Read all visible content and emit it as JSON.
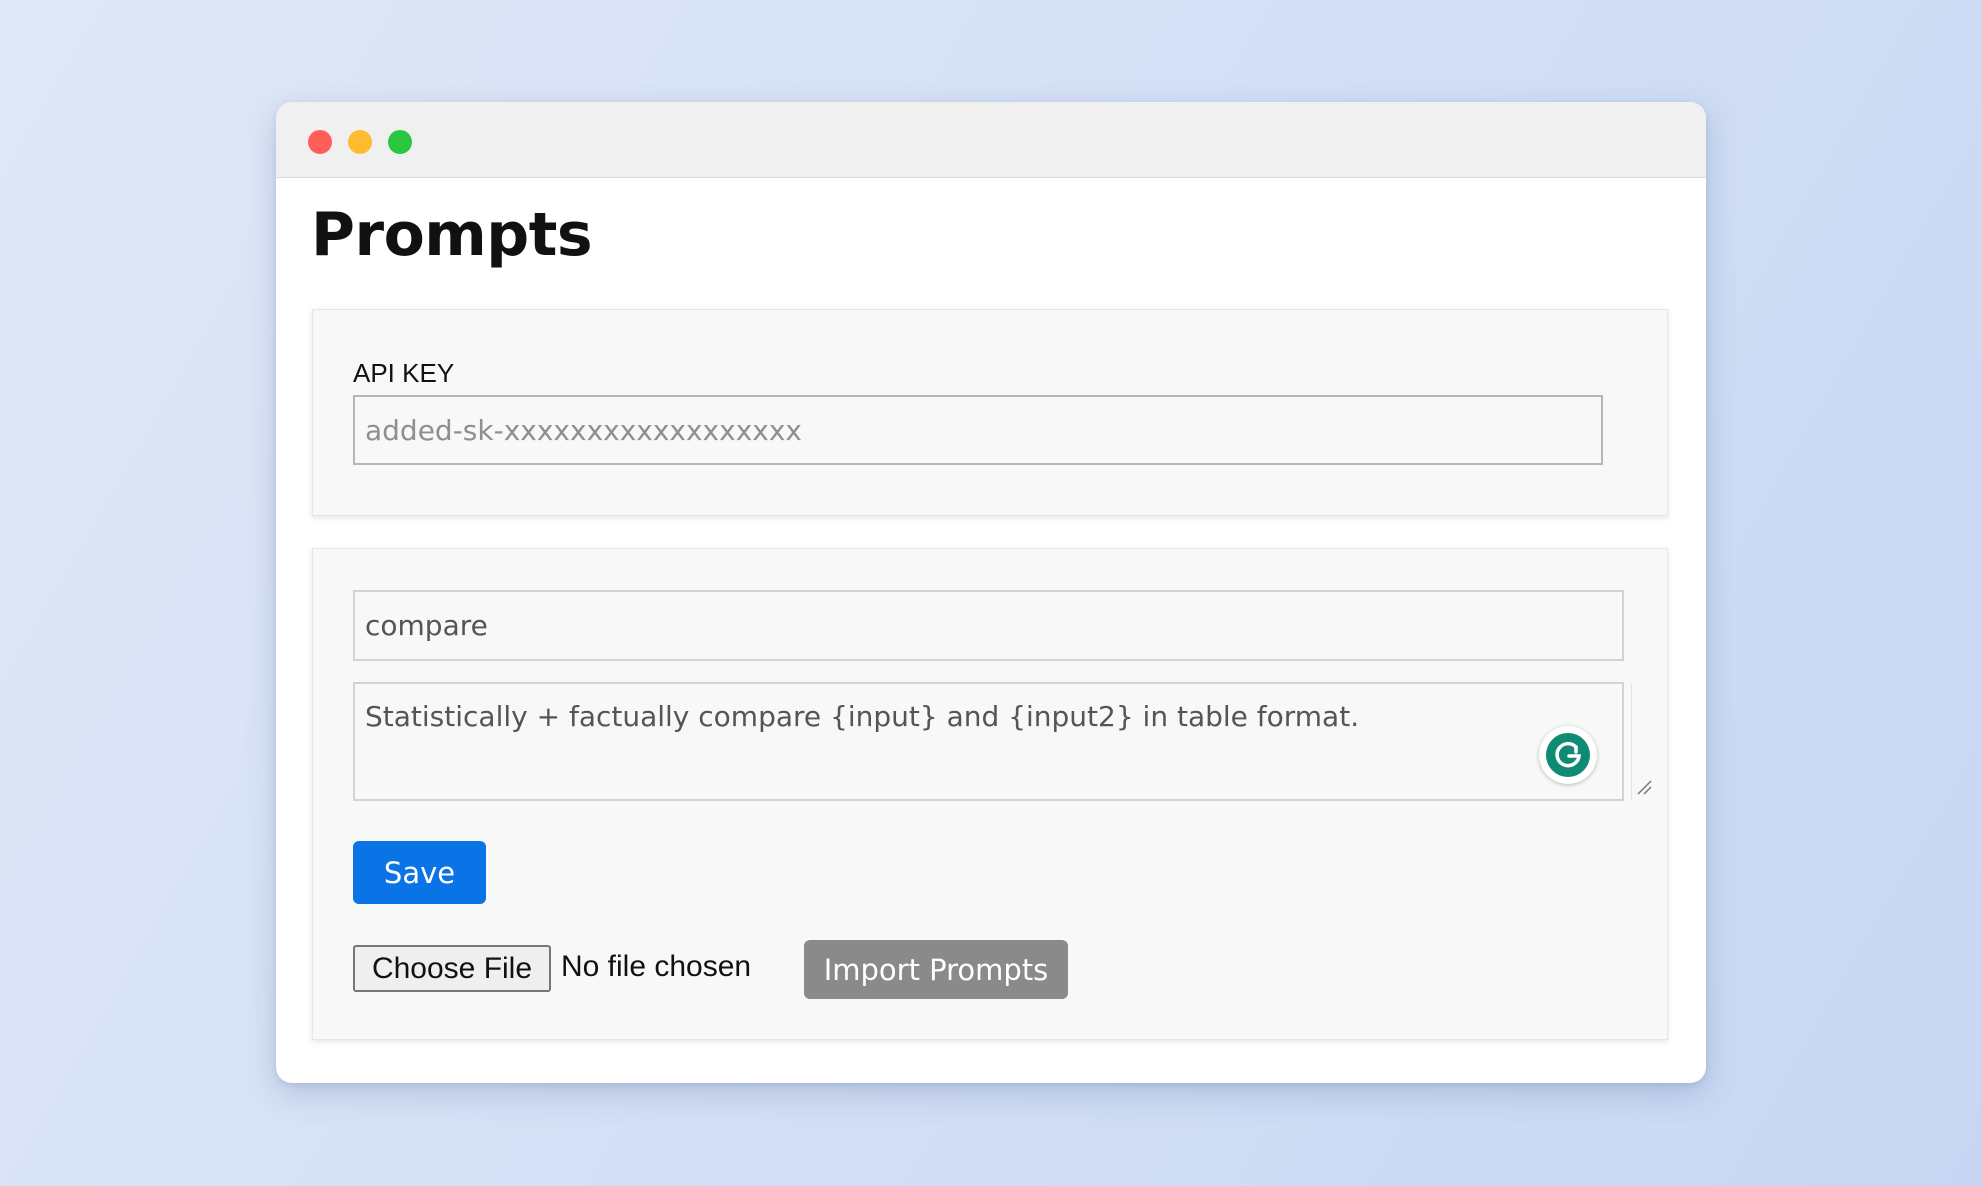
{
  "window": {
    "controls": [
      "close-dot",
      "minimize-dot",
      "zoom-dot"
    ]
  },
  "page": {
    "title": "Prompts"
  },
  "api": {
    "label": "API KEY",
    "placeholder": "added-sk-xxxxxxxxxxxxxxxxxx"
  },
  "prompt": {
    "name_value": "compare",
    "text_value": "Statistically + factually compare {input} and {input2} in table format."
  },
  "actions": {
    "save_label": "Save",
    "choose_file_label": "Choose File",
    "file_status": "No file chosen",
    "import_label": "Import Prompts"
  },
  "colors": {
    "save_button": "#0a73e6",
    "import_button": "#8a8a8a",
    "grammarly": "#15c39a"
  },
  "icons": {
    "grammarly": "grammarly-icon",
    "resize": "resize-grip-icon"
  }
}
